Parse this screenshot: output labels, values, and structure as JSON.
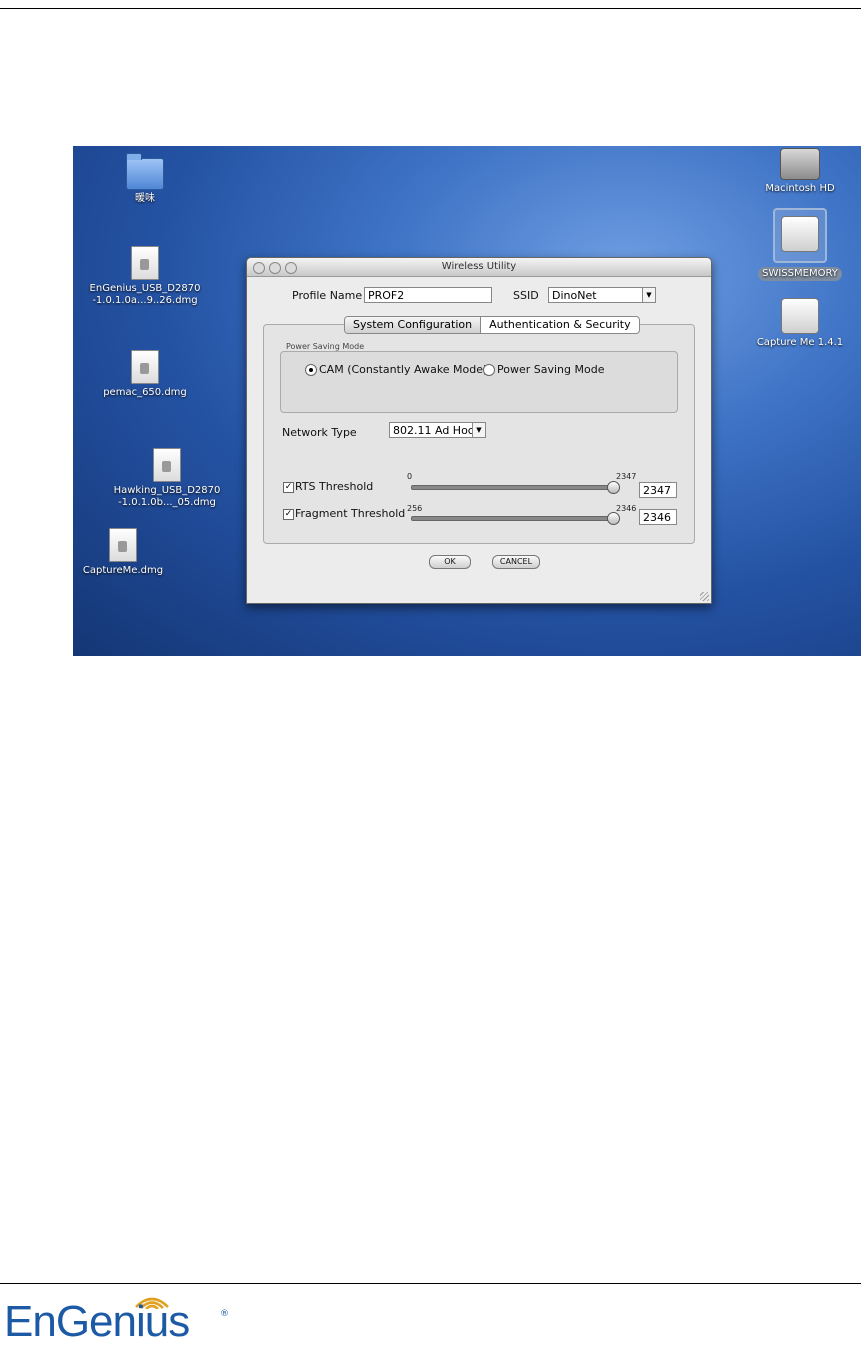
{
  "window": {
    "title": "Wireless Utility",
    "profile_name_label": "Profile Name",
    "profile_name_value": "PROF2",
    "ssid_label": "SSID",
    "ssid_value": "DinoNet",
    "tabs": [
      {
        "label": "System Configuration",
        "active": true
      },
      {
        "label": "Authentication & Security",
        "active": false
      }
    ],
    "power_group_label": "Power Saving Mode",
    "radio_cam_label": "CAM (Constantly Awake Mode)",
    "radio_psm_label": "Power Saving Mode",
    "network_type_label": "Network Type",
    "network_type_value": "802.11 Ad Hoc",
    "rts": {
      "label": "RTS Threshold",
      "min": "0",
      "max": "2347",
      "value": "2347",
      "checked": true
    },
    "fragment": {
      "label": "Fragment Threshold",
      "min": "256",
      "max": "2346",
      "value": "2346",
      "checked": true
    },
    "ok_label": "OK",
    "cancel_label": "CANCEL"
  },
  "desktop": {
    "icons_left": [
      {
        "label": "暖味"
      },
      {
        "label": "EnGenius_USB_D2870\n-1.0.1.0a...9..26.dmg"
      },
      {
        "label": "pemac_650.dmg"
      },
      {
        "label": "Hawking_USB_D2870\n-1.0.1.0b..._05.dmg"
      },
      {
        "label": "CaptureMe.dmg"
      }
    ],
    "icons_right": [
      {
        "label": "Macintosh HD"
      },
      {
        "label": "SWISSMEMORY"
      },
      {
        "label": "Capture Me 1.4.1"
      }
    ]
  },
  "logo": {
    "text": "EnGenius",
    "registered": "®",
    "brand_color": "#1d5aa6"
  },
  "colors": {
    "desktop_blue": "#2452a3",
    "window_bg": "#ececec"
  }
}
